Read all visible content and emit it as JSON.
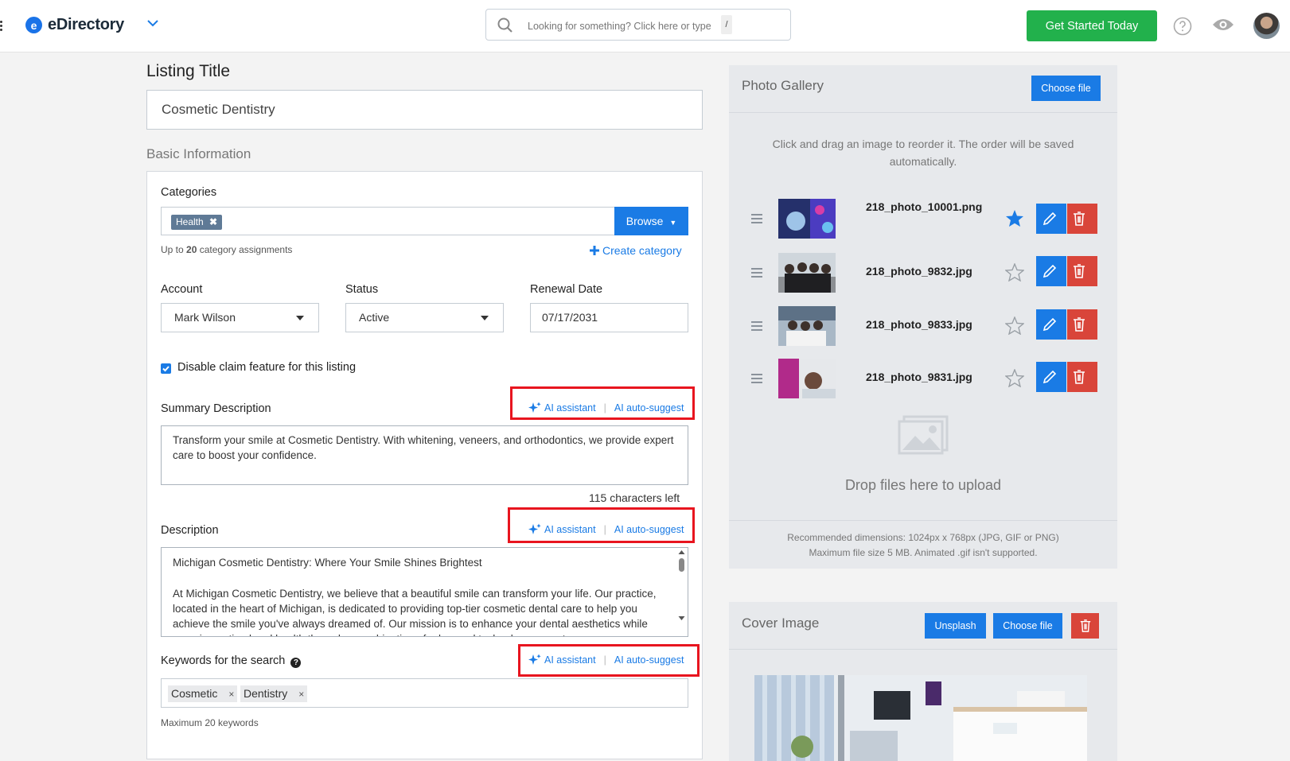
{
  "header": {
    "brand": "eDirectory",
    "search_placeholder": "Looking for something? Click here or type",
    "search_shortcut": "/",
    "cta_label": "Get Started Today"
  },
  "form": {
    "listing_title_label": "Listing Title",
    "listing_title_value": "Cosmetic Dentistry",
    "basic_info_label": "Basic Information",
    "categories_label": "Categories",
    "category_tags": [
      "Health"
    ],
    "browse_label": "Browse",
    "category_limit_prefix": "Up to ",
    "category_limit_count": "20",
    "category_limit_suffix": " category assignments",
    "create_category_label": "Create category",
    "account_label": "Account",
    "account_value": "Mark Wilson",
    "status_label": "Status",
    "status_value": "Active",
    "renewal_label": "Renewal Date",
    "renewal_value": "07/17/2031",
    "claim_label": "Disable claim feature for this listing",
    "claim_checked": true,
    "ai_assistant_label": "AI assistant",
    "ai_autosuggest_label": "AI auto-suggest",
    "summary_label": "Summary Description",
    "summary_value": "Transform your smile at Cosmetic Dentistry. With whitening, veneers, and orthodontics, we provide expert care to boost your confidence.",
    "summary_chars_left": "115 characters left",
    "description_label": "Description",
    "description_line1": "Michigan Cosmetic Dentistry: Where Your Smile Shines Brightest",
    "description_line2": "At Michigan Cosmetic Dentistry, we believe that a beautiful smile can transform your life. Our practice, located in the heart of Michigan, is dedicated to providing top-tier cosmetic dental care to help you achieve the smile you've always dreamed of. Our mission is to enhance your dental aesthetics while ensuring optimal oral health through a combination of advanced technology, expert",
    "keywords_label": "Keywords for the search",
    "keywords": [
      "Cosmetic",
      "Dentistry"
    ],
    "keywords_limit": "Maximum 20 keywords"
  },
  "gallery": {
    "title": "Photo Gallery",
    "choose_file_label": "Choose file",
    "hint": "Click and drag an image to reorder it. The order will be saved automatically.",
    "photos": [
      {
        "name": "218_photo_10001.png",
        "featured": true
      },
      {
        "name": "218_photo_9832.jpg",
        "featured": false
      },
      {
        "name": "218_photo_9833.jpg",
        "featured": false
      },
      {
        "name": "218_photo_9831.jpg",
        "featured": false
      }
    ],
    "drop_text": "Drop files here to upload",
    "recommended_line1": "Recommended dimensions: 1024px x 768px (JPG, GIF or PNG)",
    "recommended_line2": "Maximum file size 5 MB. Animated .gif isn't supported."
  },
  "cover": {
    "title": "Cover Image",
    "unsplash_label": "Unsplash",
    "choose_file_label": "Choose file"
  },
  "colors": {
    "primary": "#1a7be5",
    "success": "#22b14c",
    "danger": "#d9453a",
    "highlight": "#e8151f"
  }
}
